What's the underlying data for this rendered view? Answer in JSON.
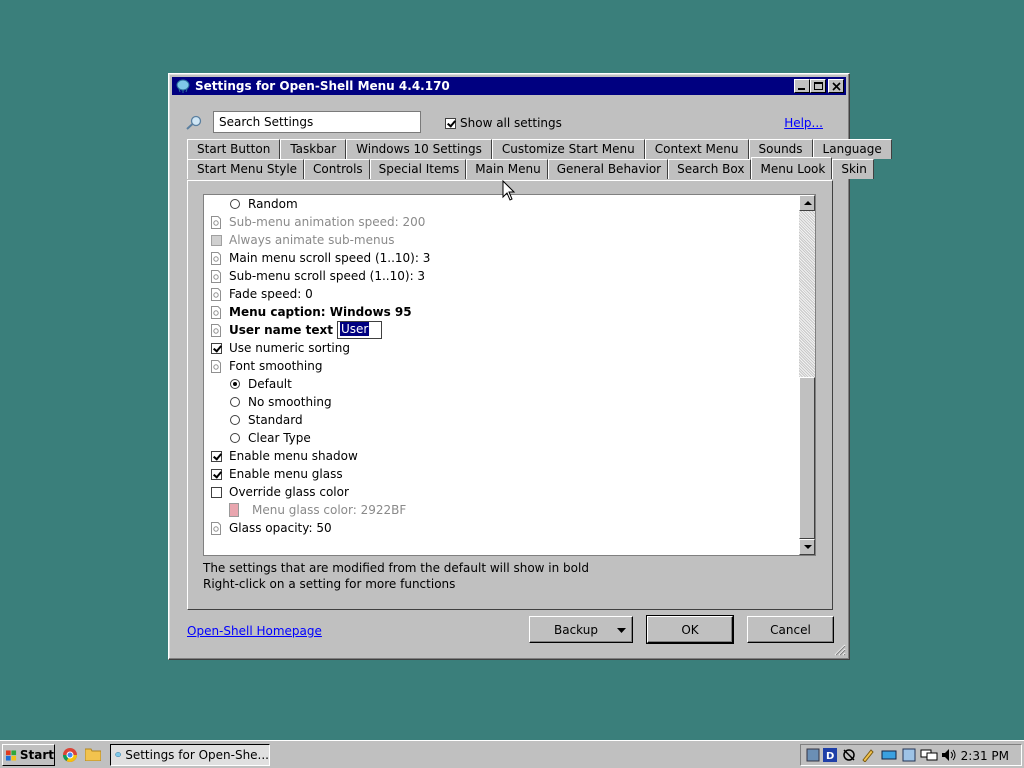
{
  "window": {
    "title": "Settings for Open-Shell Menu 4.4.170"
  },
  "search": {
    "placeholder": "Search Settings",
    "value": "",
    "show_all_label": "Show all settings",
    "show_all_checked": true,
    "help_label": "Help..."
  },
  "tabs_row1": [
    "Start Button",
    "Taskbar",
    "Windows 10 Settings",
    "Customize Start Menu",
    "Context Menu",
    "Sounds",
    "Language"
  ],
  "tabs_row2": [
    "Start Menu Style",
    "Controls",
    "Special Items",
    "Main Menu",
    "General Behavior",
    "Search Box",
    "Menu Look",
    "Skin"
  ],
  "active_tab": "Menu Look",
  "settings": [
    {
      "label": "Random",
      "kind": "radio",
      "checked": false,
      "indent": 1,
      "style": "normal"
    },
    {
      "label": "Sub-menu animation speed: 200",
      "kind": "setting",
      "indent": 0,
      "style": "disabled"
    },
    {
      "label": "Always animate sub-menus",
      "kind": "checkbox",
      "checked": false,
      "indent": 0,
      "style": "disabled"
    },
    {
      "label": "Main menu scroll speed (1..10): 3",
      "kind": "setting",
      "indent": 0,
      "style": "normal"
    },
    {
      "label": "Sub-menu scroll speed (1..10): 3",
      "kind": "setting",
      "indent": 0,
      "style": "normal"
    },
    {
      "label": "Fade speed: 0",
      "kind": "setting",
      "indent": 0,
      "style": "normal"
    },
    {
      "label": "Menu caption: Windows 95",
      "kind": "setting",
      "indent": 0,
      "style": "bold"
    },
    {
      "label": "User name text",
      "kind": "setting-edit",
      "edit_value": "User",
      "indent": 0,
      "style": "bold"
    },
    {
      "label": "Use numeric sorting",
      "kind": "checkbox",
      "checked": true,
      "indent": 0,
      "style": "normal"
    },
    {
      "label": "Font smoothing",
      "kind": "setting",
      "indent": 0,
      "style": "normal"
    },
    {
      "label": "Default",
      "kind": "radio",
      "checked": true,
      "indent": 1,
      "style": "normal"
    },
    {
      "label": "No smoothing",
      "kind": "radio",
      "checked": false,
      "indent": 1,
      "style": "normal"
    },
    {
      "label": "Standard",
      "kind": "radio",
      "checked": false,
      "indent": 1,
      "style": "normal"
    },
    {
      "label": "Clear Type",
      "kind": "radio",
      "checked": false,
      "indent": 1,
      "style": "normal"
    },
    {
      "label": "Enable menu shadow",
      "kind": "checkbox",
      "checked": true,
      "indent": 0,
      "style": "normal"
    },
    {
      "label": "Enable menu glass",
      "kind": "checkbox",
      "checked": true,
      "indent": 0,
      "style": "normal"
    },
    {
      "label": "Override glass color",
      "kind": "checkbox",
      "checked": false,
      "indent": 0,
      "style": "normal"
    },
    {
      "label": "Menu glass color: 2922BF",
      "kind": "color",
      "indent": 1,
      "style": "disabled",
      "swatch_color": "#e8a5ae"
    },
    {
      "label": "Glass opacity: 50",
      "kind": "setting",
      "indent": 0,
      "style": "normal"
    }
  ],
  "hints": {
    "line1": "The settings that are modified from the default will show in bold",
    "line2": "Right-click on a setting for more functions"
  },
  "footer": {
    "homepage_link": "Open-Shell Homepage",
    "backup_label": "Backup",
    "ok_label": "OK",
    "cancel_label": "Cancel"
  },
  "taskbar": {
    "start_label": "Start",
    "task_label": "Settings for Open-She...",
    "clock": "2:31 PM"
  },
  "colors": {
    "desktop": "#3a7f7b",
    "title_bar": "#000080",
    "face": "#c0c0c0",
    "link": "#0000ff"
  }
}
